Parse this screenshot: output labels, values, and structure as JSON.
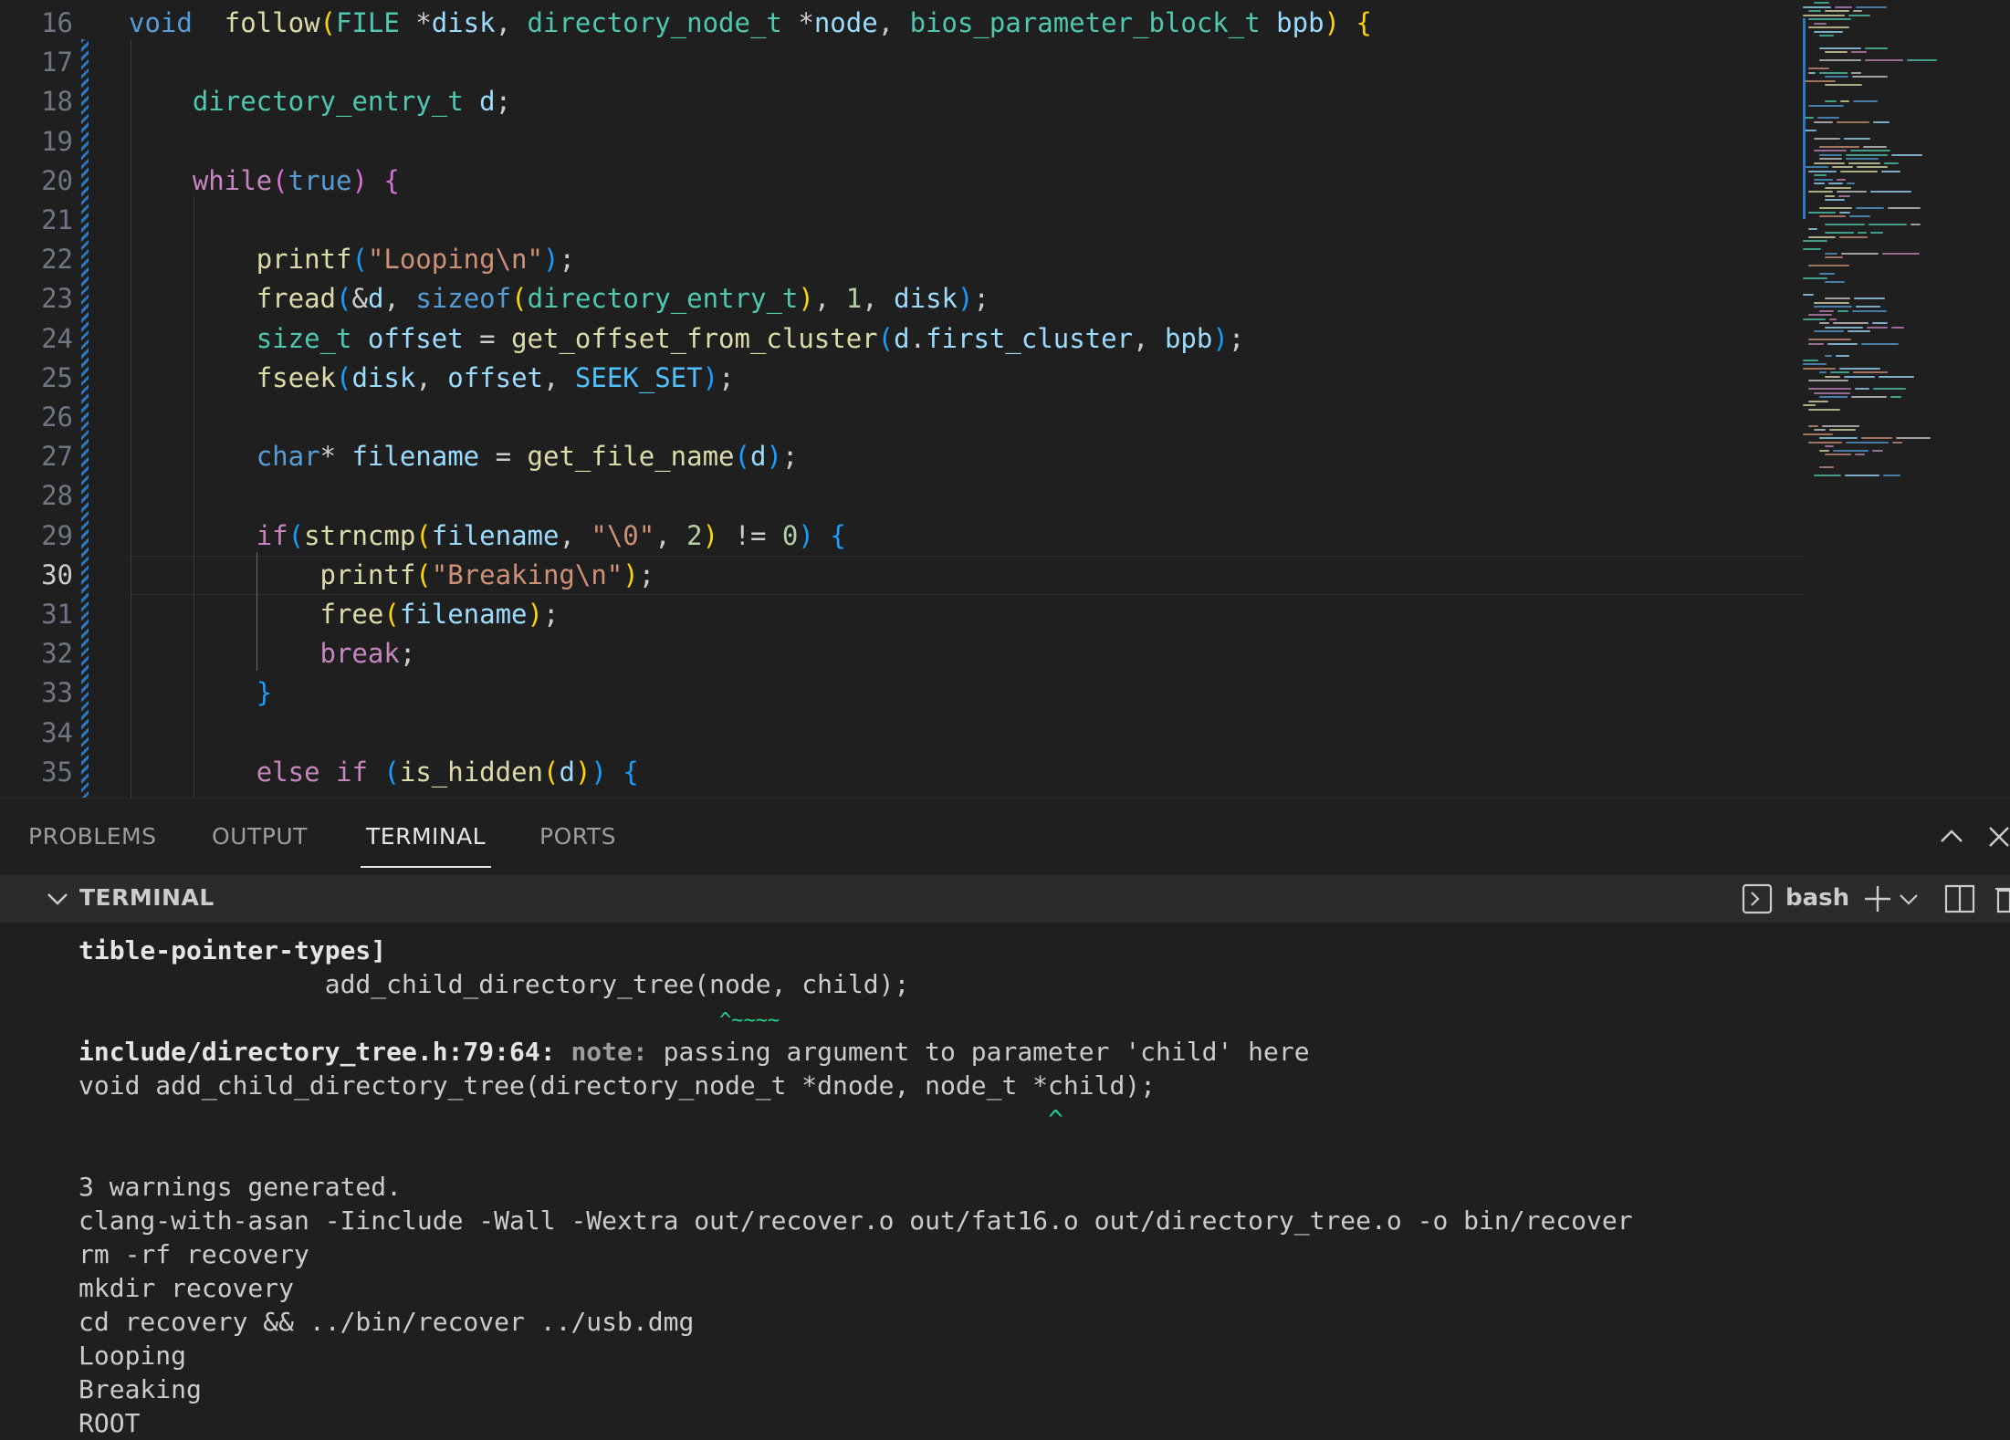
{
  "editor": {
    "active_line": "30",
    "lines": [
      {
        "n": "16",
        "tokens": [
          [
            "kw",
            "void"
          ],
          [
            "",
            "  "
          ],
          [
            "fn",
            "follow"
          ],
          [
            "b1",
            "("
          ],
          [
            "ty",
            "FILE"
          ],
          [
            "",
            " *"
          ],
          [
            "var",
            "disk"
          ],
          [
            "",
            ", "
          ],
          [
            "ty",
            "directory_node_t"
          ],
          [
            "",
            " *"
          ],
          [
            "var",
            "node"
          ],
          [
            "",
            ", "
          ],
          [
            "ty",
            "bios_parameter_block_t"
          ],
          [
            "",
            " "
          ],
          [
            "var",
            "bpb"
          ],
          [
            "b1",
            ")"
          ],
          [
            "",
            " "
          ],
          [
            "b1",
            "{"
          ]
        ]
      },
      {
        "n": "17",
        "tokens": []
      },
      {
        "n": "18",
        "tokens": [
          [
            "",
            "    "
          ],
          [
            "ty",
            "directory_entry_t"
          ],
          [
            "",
            " "
          ],
          [
            "var",
            "d"
          ],
          [
            "",
            ";"
          ]
        ]
      },
      {
        "n": "19",
        "tokens": []
      },
      {
        "n": "20",
        "tokens": [
          [
            "",
            "    "
          ],
          [
            "ctl",
            "while"
          ],
          [
            "b2",
            "("
          ],
          [
            "kw",
            "true"
          ],
          [
            "b2",
            ")"
          ],
          [
            "",
            " "
          ],
          [
            "b2",
            "{"
          ]
        ]
      },
      {
        "n": "21",
        "tokens": []
      },
      {
        "n": "22",
        "tokens": [
          [
            "",
            "        "
          ],
          [
            "fn",
            "printf"
          ],
          [
            "b3",
            "("
          ],
          [
            "str",
            "\"Looping\\n\""
          ],
          [
            "b3",
            ")"
          ],
          [
            "",
            ";"
          ]
        ]
      },
      {
        "n": "23",
        "tokens": [
          [
            "",
            "        "
          ],
          [
            "fn",
            "fread"
          ],
          [
            "b3",
            "("
          ],
          [
            "",
            "&"
          ],
          [
            "var",
            "d"
          ],
          [
            "",
            ", "
          ],
          [
            "kw",
            "sizeof"
          ],
          [
            "b1",
            "("
          ],
          [
            "ty",
            "directory_entry_t"
          ],
          [
            "b1",
            ")"
          ],
          [
            "",
            ", "
          ],
          [
            "num",
            "1"
          ],
          [
            "",
            ", "
          ],
          [
            "var",
            "disk"
          ],
          [
            "b3",
            ")"
          ],
          [
            "",
            ";"
          ]
        ]
      },
      {
        "n": "24",
        "tokens": [
          [
            "",
            "        "
          ],
          [
            "ty",
            "size_t"
          ],
          [
            "",
            " "
          ],
          [
            "var",
            "offset"
          ],
          [
            "",
            " = "
          ],
          [
            "fn",
            "get_offset_from_cluster"
          ],
          [
            "b3",
            "("
          ],
          [
            "var",
            "d"
          ],
          [
            "",
            "."
          ],
          [
            "var",
            "first_cluster"
          ],
          [
            "",
            ", "
          ],
          [
            "var",
            "bpb"
          ],
          [
            "b3",
            ")"
          ],
          [
            "",
            ";"
          ]
        ]
      },
      {
        "n": "25",
        "tokens": [
          [
            "",
            "        "
          ],
          [
            "fn",
            "fseek"
          ],
          [
            "b3",
            "("
          ],
          [
            "var",
            "disk"
          ],
          [
            "",
            ", "
          ],
          [
            "var",
            "offset"
          ],
          [
            "",
            ", "
          ],
          [
            "con",
            "SEEK_SET"
          ],
          [
            "b3",
            ")"
          ],
          [
            "",
            ";"
          ]
        ]
      },
      {
        "n": "26",
        "tokens": []
      },
      {
        "n": "27",
        "tokens": [
          [
            "",
            "        "
          ],
          [
            "kw",
            "char"
          ],
          [
            "",
            "* "
          ],
          [
            "var",
            "filename"
          ],
          [
            "",
            " = "
          ],
          [
            "fn",
            "get_file_name"
          ],
          [
            "b3",
            "("
          ],
          [
            "var",
            "d"
          ],
          [
            "b3",
            ")"
          ],
          [
            "",
            ";"
          ]
        ]
      },
      {
        "n": "28",
        "tokens": []
      },
      {
        "n": "29",
        "tokens": [
          [
            "",
            "        "
          ],
          [
            "ctl",
            "if"
          ],
          [
            "b3",
            "("
          ],
          [
            "fn",
            "strncmp"
          ],
          [
            "b1",
            "("
          ],
          [
            "var",
            "filename"
          ],
          [
            "",
            ", "
          ],
          [
            "str",
            "\"\\0\""
          ],
          [
            "",
            ", "
          ],
          [
            "num",
            "2"
          ],
          [
            "b1",
            ")"
          ],
          [
            "",
            " != "
          ],
          [
            "num",
            "0"
          ],
          [
            "b3",
            ")"
          ],
          [
            "",
            " "
          ],
          [
            "b3",
            "{"
          ]
        ]
      },
      {
        "n": "30",
        "tokens": [
          [
            "",
            "            "
          ],
          [
            "fn",
            "printf"
          ],
          [
            "b1",
            "("
          ],
          [
            "str",
            "\"Breaking\\n\""
          ],
          [
            "b1",
            ")"
          ],
          [
            "",
            ";"
          ]
        ]
      },
      {
        "n": "31",
        "tokens": [
          [
            "",
            "            "
          ],
          [
            "fn",
            "free"
          ],
          [
            "b1",
            "("
          ],
          [
            "var",
            "filename"
          ],
          [
            "b1",
            ")"
          ],
          [
            "",
            ";"
          ]
        ]
      },
      {
        "n": "32",
        "tokens": [
          [
            "",
            "            "
          ],
          [
            "ctl",
            "break"
          ],
          [
            "",
            ";"
          ]
        ]
      },
      {
        "n": "33",
        "tokens": [
          [
            "",
            "        "
          ],
          [
            "b3",
            "}"
          ]
        ]
      },
      {
        "n": "34",
        "tokens": []
      },
      {
        "n": "35",
        "tokens": [
          [
            "",
            "        "
          ],
          [
            "ctl",
            "else"
          ],
          [
            "",
            " "
          ],
          [
            "ctl",
            "if"
          ],
          [
            "",
            " "
          ],
          [
            "b3",
            "("
          ],
          [
            "fn",
            "is_hidden"
          ],
          [
            "b1",
            "("
          ],
          [
            "var",
            "d"
          ],
          [
            "b1",
            ")"
          ],
          [
            "b3",
            ")"
          ],
          [
            "",
            " "
          ],
          [
            "b3",
            "{"
          ]
        ]
      }
    ]
  },
  "panel": {
    "tabs": [
      "PROBLEMS",
      "OUTPUT",
      "TERMINAL",
      "PORTS"
    ],
    "active_tab": "TERMINAL",
    "terminal_title": "TERMINAL",
    "shell": "bash"
  },
  "terminal": {
    "lines": [
      [
        [
          "bold",
          "tible-pointer-types]"
        ]
      ],
      [
        [
          "",
          "                add_child_directory_tree(node, child);"
        ]
      ],
      [
        [
          "squig",
          "                                                     ^~~~~"
        ]
      ],
      [
        [
          "bold",
          "include/directory_tree.h:79:64: "
        ],
        [
          "note",
          "note: "
        ],
        [
          "",
          "passing argument to parameter 'child' here"
        ]
      ],
      [
        [
          "",
          "void add_child_directory_tree(directory_node_t *dnode, node_t *child);"
        ]
      ],
      [
        [
          "green",
          "                                                               ^"
        ]
      ],
      [
        [
          "",
          ""
        ]
      ],
      [
        [
          "",
          "3 warnings generated."
        ]
      ],
      [
        [
          "",
          "clang-with-asan -Iinclude -Wall -Wextra out/recover.o out/fat16.o out/directory_tree.o -o bin/recover"
        ]
      ],
      [
        [
          "",
          "rm -rf recovery"
        ]
      ],
      [
        [
          "",
          "mkdir recovery"
        ]
      ],
      [
        [
          "",
          "cd recovery && ../bin/recover ../usb.dmg"
        ]
      ],
      [
        [
          "",
          "Looping"
        ]
      ],
      [
        [
          "",
          "Breaking"
        ]
      ],
      [
        [
          "",
          "ROOT"
        ]
      ]
    ]
  },
  "icons": {
    "maximize": "chevron-up-icon",
    "close": "close-icon",
    "collapse": "chevron-down-icon",
    "terminal": "terminal-icon",
    "add": "plus-icon",
    "split": "split-icon",
    "trash": "trash-icon"
  }
}
